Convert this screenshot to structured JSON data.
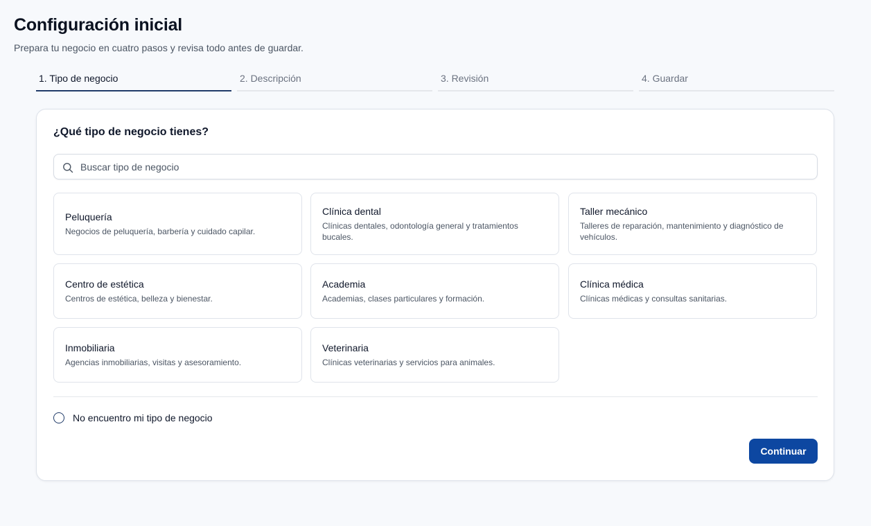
{
  "page": {
    "title": "Configuración inicial",
    "subtitle": "Prepara tu negocio en cuatro pasos y revisa todo antes de guardar."
  },
  "steps": [
    {
      "label": "1. Tipo de negocio",
      "active": true
    },
    {
      "label": "2. Descripción",
      "active": false
    },
    {
      "label": "3. Revisión",
      "active": false
    },
    {
      "label": "4. Guardar",
      "active": false
    }
  ],
  "question": "¿Qué tipo de negocio tienes?",
  "search": {
    "placeholder": "Buscar tipo de negocio",
    "value": "",
    "icon": "search-icon"
  },
  "options": [
    {
      "title": "Peluquería",
      "description": "Negocios de peluquería, barbería y cuidado capilar."
    },
    {
      "title": "Clínica dental",
      "description": "Clínicas dentales, odontología general y tratamientos bucales."
    },
    {
      "title": "Taller mecánico",
      "description": "Talleres de reparación, mantenimiento y diagnóstico de vehículos."
    },
    {
      "title": "Centro de estética",
      "description": "Centros de estética, belleza y bienestar."
    },
    {
      "title": "Academia",
      "description": "Academias, clases particulares y formación."
    },
    {
      "title": "Clínica médica",
      "description": "Clínicas médicas y consultas sanitarias."
    },
    {
      "title": "Inmobiliaria",
      "description": "Agencias inmobiliarias, visitas y asesoramiento."
    },
    {
      "title": "Veterinaria",
      "description": "Clínicas veterinarias y servicios para animales."
    }
  ],
  "not_found": {
    "label": "No encuentro mi tipo de negocio",
    "checked": false
  },
  "continue_label": "Continuar",
  "colors": {
    "accent": "#0d47a1",
    "active_step": "#1f3a68",
    "background": "#f7f9fc"
  }
}
